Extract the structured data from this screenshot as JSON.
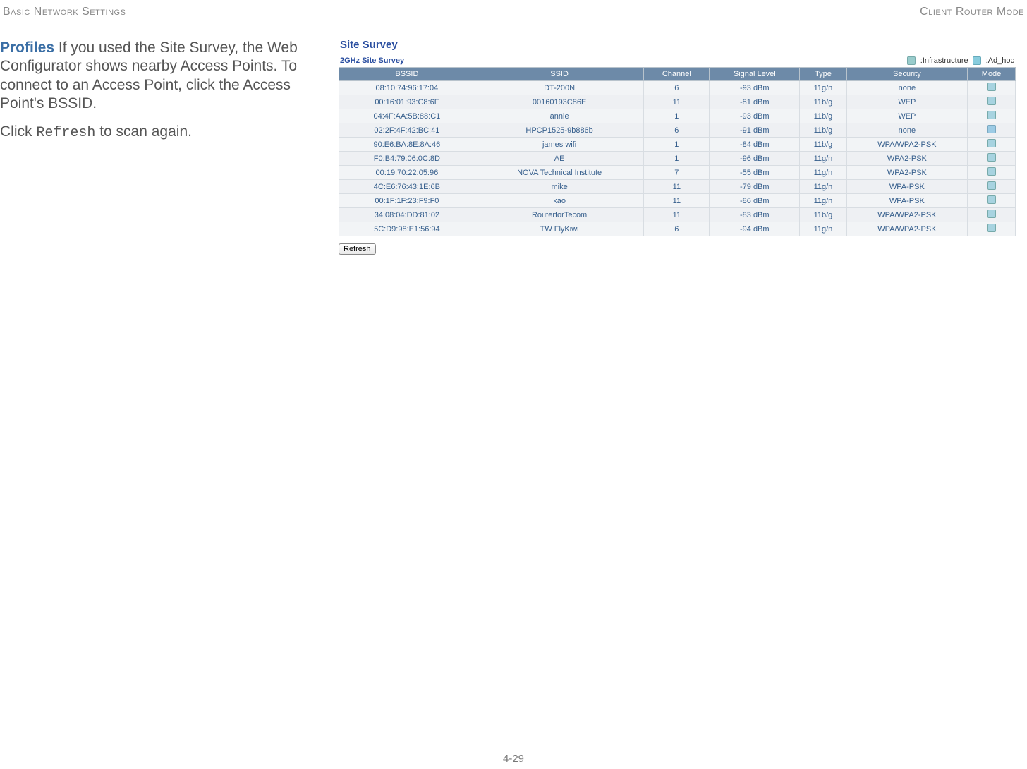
{
  "header": {
    "left": "Basic Network Settings",
    "right": "Client Router Mode"
  },
  "left": {
    "profiles_label": "Profiles",
    "profiles_text": "  If you used the Site Survey, the Web Configurator shows nearby Access Points. To connect to an Access Point, click the Access Point's BSSID.",
    "refresh_sentence_prefix": "Click ",
    "refresh_word": "Refresh",
    "refresh_sentence_suffix": " to scan again."
  },
  "panel": {
    "title": "Site Survey",
    "subtitle": "2GHz Site Survey",
    "legend_infra": ":Infrastructure",
    "legend_adhoc": ":Ad_hoc",
    "columns": [
      "BSSID",
      "SSID",
      "Channel",
      "Signal Level",
      "Type",
      "Security",
      "Mode"
    ],
    "rows": [
      {
        "bssid": "08:10:74:96:17:04",
        "ssid": "DT-200N",
        "channel": "6",
        "signal": "-93 dBm",
        "type": "11g/n",
        "security": "none",
        "mode": "infra"
      },
      {
        "bssid": "00:16:01:93:C8:6F",
        "ssid": "00160193C86E",
        "channel": "11",
        "signal": "-81 dBm",
        "type": "11b/g",
        "security": "WEP",
        "mode": "infra"
      },
      {
        "bssid": "04:4F:AA:5B:88:C1",
        "ssid": "annie",
        "channel": "1",
        "signal": "-93 dBm",
        "type": "11b/g",
        "security": "WEP",
        "mode": "infra"
      },
      {
        "bssid": "02:2F:4F:42:BC:41",
        "ssid": "HPCP1525-9b886b",
        "channel": "6",
        "signal": "-91 dBm",
        "type": "11b/g",
        "security": "none",
        "mode": "adhoc"
      },
      {
        "bssid": "90:E6:BA:8E:8A:46",
        "ssid": "james wifi",
        "channel": "1",
        "signal": "-84 dBm",
        "type": "11b/g",
        "security": "WPA/WPA2-PSK",
        "mode": "infra"
      },
      {
        "bssid": "F0:B4:79:06:0C:8D",
        "ssid": "AE",
        "channel": "1",
        "signal": "-96 dBm",
        "type": "11g/n",
        "security": "WPA2-PSK",
        "mode": "infra"
      },
      {
        "bssid": "00:19:70:22:05:96",
        "ssid": "NOVA Technical Institute",
        "channel": "7",
        "signal": "-55 dBm",
        "type": "11g/n",
        "security": "WPA2-PSK",
        "mode": "infra"
      },
      {
        "bssid": "4C:E6:76:43:1E:6B",
        "ssid": "mike",
        "channel": "11",
        "signal": "-79 dBm",
        "type": "11g/n",
        "security": "WPA-PSK",
        "mode": "infra"
      },
      {
        "bssid": "00:1F:1F:23:F9:F0",
        "ssid": "kao",
        "channel": "11",
        "signal": "-86 dBm",
        "type": "11g/n",
        "security": "WPA-PSK",
        "mode": "infra"
      },
      {
        "bssid": "34:08:04:DD:81:02",
        "ssid": "RouterforTecom",
        "channel": "11",
        "signal": "-83 dBm",
        "type": "11b/g",
        "security": "WPA/WPA2-PSK",
        "mode": "infra"
      },
      {
        "bssid": "5C:D9:98:E1:56:94",
        "ssid": "TW FlyKiwi",
        "channel": "6",
        "signal": "-94 dBm",
        "type": "11g/n",
        "security": "WPA/WPA2-PSK",
        "mode": "infra"
      }
    ],
    "refresh_button": "Refresh"
  },
  "page_number": "4-29"
}
